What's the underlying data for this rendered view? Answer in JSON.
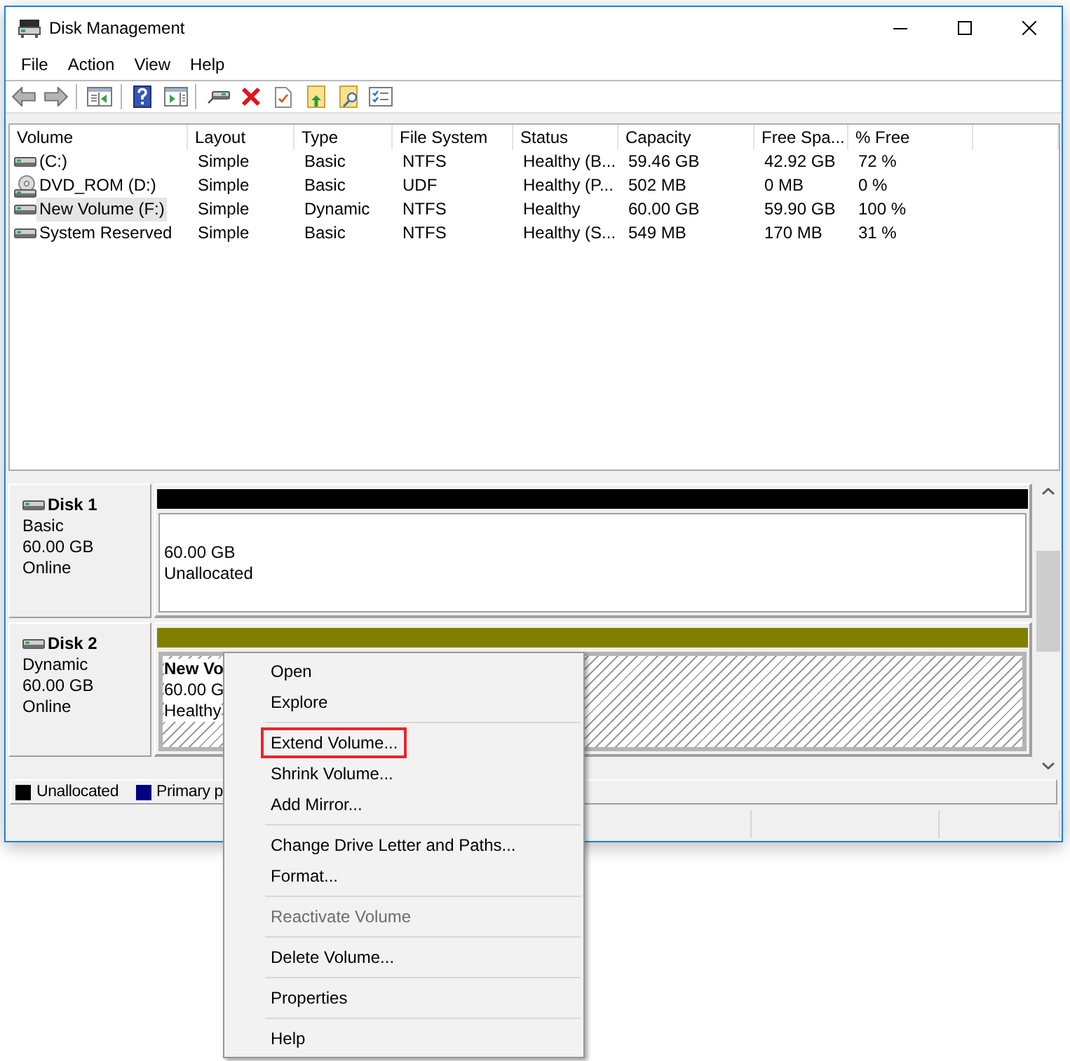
{
  "window": {
    "title": "Disk Management"
  },
  "menu_bar": {
    "items": [
      "File",
      "Action",
      "View",
      "Help"
    ]
  },
  "volume_list": {
    "columns": [
      "Volume",
      "Layout",
      "Type",
      "File System",
      "Status",
      "Capacity",
      "Free Spa...",
      "% Free"
    ],
    "rows": [
      {
        "kind": "drive",
        "selected": false,
        "cells": [
          "(C:)",
          "Simple",
          "Basic",
          "NTFS",
          "Healthy (B...",
          "59.46 GB",
          "42.92 GB",
          "72 %"
        ]
      },
      {
        "kind": "disc",
        "selected": false,
        "cells": [
          "DVD_ROM (D:)",
          "Simple",
          "Basic",
          "UDF",
          "Healthy (P...",
          "502 MB",
          "0 MB",
          "0 %"
        ]
      },
      {
        "kind": "drive",
        "selected": true,
        "cells": [
          "New Volume (F:)",
          "Simple",
          "Dynamic",
          "NTFS",
          "Healthy",
          "60.00 GB",
          "59.90 GB",
          "100 %"
        ]
      },
      {
        "kind": "drive",
        "selected": false,
        "cells": [
          "System Reserved",
          "Simple",
          "Basic",
          "NTFS",
          "Healthy (S...",
          "549 MB",
          "170 MB",
          "31 %"
        ]
      }
    ]
  },
  "disks": [
    {
      "name": "Disk 1",
      "type": "Basic",
      "size": "60.00 GB",
      "status": "Online",
      "partitions": [
        {
          "kind": "unallocated",
          "color": "#000000",
          "selected": false,
          "lines": [
            "60.00 GB",
            "Unallocated"
          ]
        }
      ]
    },
    {
      "name": "Disk 2",
      "type": "Dynamic",
      "size": "60.00 GB",
      "status": "Online",
      "partitions": [
        {
          "kind": "volume",
          "color": "#808000",
          "selected": true,
          "lines": [
            "New Vo",
            "60.00 G",
            "Healthy"
          ]
        }
      ]
    }
  ],
  "legend": [
    {
      "label": "Unallocated",
      "color": "#000000"
    },
    {
      "label": "Primary p",
      "color": "#000080"
    }
  ],
  "context_menu": {
    "items": [
      {
        "kind": "item",
        "label": "Open",
        "disabled": false,
        "highlighted": false
      },
      {
        "kind": "item",
        "label": "Explore",
        "disabled": false,
        "highlighted": false
      },
      {
        "kind": "separator"
      },
      {
        "kind": "item",
        "label": "Extend Volume...",
        "disabled": false,
        "highlighted": true
      },
      {
        "kind": "item",
        "label": "Shrink Volume...",
        "disabled": false,
        "highlighted": false
      },
      {
        "kind": "item",
        "label": "Add Mirror...",
        "disabled": false,
        "highlighted": false
      },
      {
        "kind": "separator"
      },
      {
        "kind": "item",
        "label": "Change Drive Letter and Paths...",
        "disabled": false,
        "highlighted": false
      },
      {
        "kind": "item",
        "label": "Format...",
        "disabled": false,
        "highlighted": false
      },
      {
        "kind": "separator"
      },
      {
        "kind": "item",
        "label": "Reactivate Volume",
        "disabled": true,
        "highlighted": false
      },
      {
        "kind": "separator"
      },
      {
        "kind": "item",
        "label": "Delete Volume...",
        "disabled": false,
        "highlighted": false
      },
      {
        "kind": "separator"
      },
      {
        "kind": "item",
        "label": "Properties",
        "disabled": false,
        "highlighted": false
      },
      {
        "kind": "separator"
      },
      {
        "kind": "item",
        "label": "Help",
        "disabled": false,
        "highlighted": false
      }
    ]
  }
}
